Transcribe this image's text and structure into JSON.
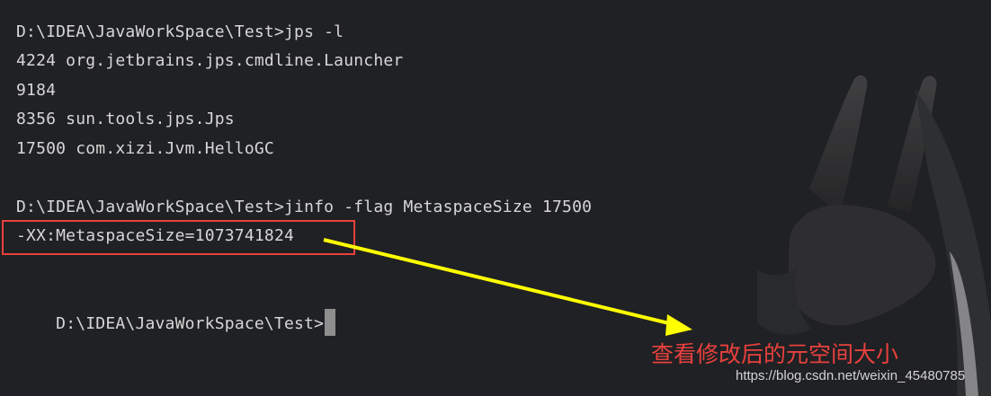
{
  "terminal": {
    "lines": [
      "D:\\IDEA\\JavaWorkSpace\\Test>jps -l",
      "4224 org.jetbrains.jps.cmdline.Launcher",
      "9184",
      "8356 sun.tools.jps.Jps",
      "17500 com.xizi.Jvm.HelloGC",
      "",
      "D:\\IDEA\\JavaWorkSpace\\Test>jinfo -flag MetaspaceSize 17500",
      "-XX:MetaspaceSize=1073741824",
      "",
      "D:\\IDEA\\JavaWorkSpace\\Test>"
    ]
  },
  "annotation": {
    "text": "查看修改后的元空间大小"
  },
  "watermark": {
    "text": "https://blog.csdn.net/weixin_45480785"
  },
  "colors": {
    "background": "#202124",
    "text": "#d7d7d7",
    "box": "#e8413d",
    "arrow": "#ffff00",
    "annotation": "#e8413d"
  }
}
